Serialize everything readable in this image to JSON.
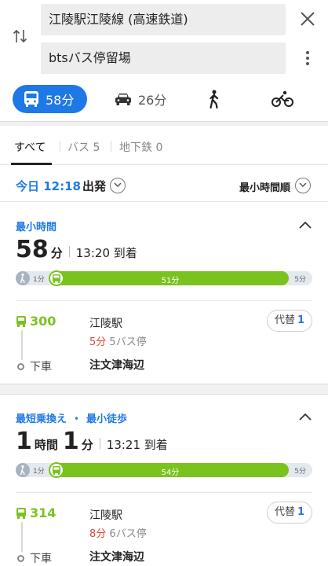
{
  "search": {
    "from": "江陵駅江陵線 (高速鉄道)",
    "to": "btsバス停留場"
  },
  "modes": {
    "bus": "58分",
    "car": "26分"
  },
  "filters": {
    "all": "すべて",
    "bus": "バス 5",
    "subway": "地下鉄 0"
  },
  "depart": {
    "time": "今日 12:18",
    "suffix": "出発",
    "sort": "最小時間順"
  },
  "routes": [
    {
      "tag": "最小時間",
      "tag2": "",
      "dur": [
        {
          "n": "58",
          "u": "分"
        }
      ],
      "arrive": "13:20 到着",
      "walk_start": "1分",
      "ride": "51分",
      "walk_end": "5分",
      "ride_fraction": 0.84,
      "bus_no": "300",
      "board_stop": "江陵駅",
      "wait_min": "5分",
      "wait_stops": "5バス停",
      "alt_label": "代替",
      "alt_count": "1",
      "get_off": "下車",
      "dest_stop": "注文津海辺"
    },
    {
      "tag": "最短乗換え",
      "tag_sep": "・",
      "tag2": "最小徒歩",
      "dur": [
        {
          "n": "1",
          "u": "時間"
        },
        {
          "n": "1",
          "u": "分"
        }
      ],
      "arrive": "13:21 到着",
      "walk_start": "1分",
      "ride": "54分",
      "walk_end": "5分",
      "ride_fraction": 0.84,
      "bus_no": "314",
      "board_stop": "江陵駅",
      "wait_min": "8分",
      "wait_stops": "6バス停",
      "alt_label": "代替",
      "alt_count": "1",
      "get_off": "下車",
      "dest_stop": "注文津海辺"
    }
  ],
  "colors": {
    "accent": "#1e78e6",
    "bus_green": "#7ac31f",
    "wait_red": "#e0463a"
  }
}
